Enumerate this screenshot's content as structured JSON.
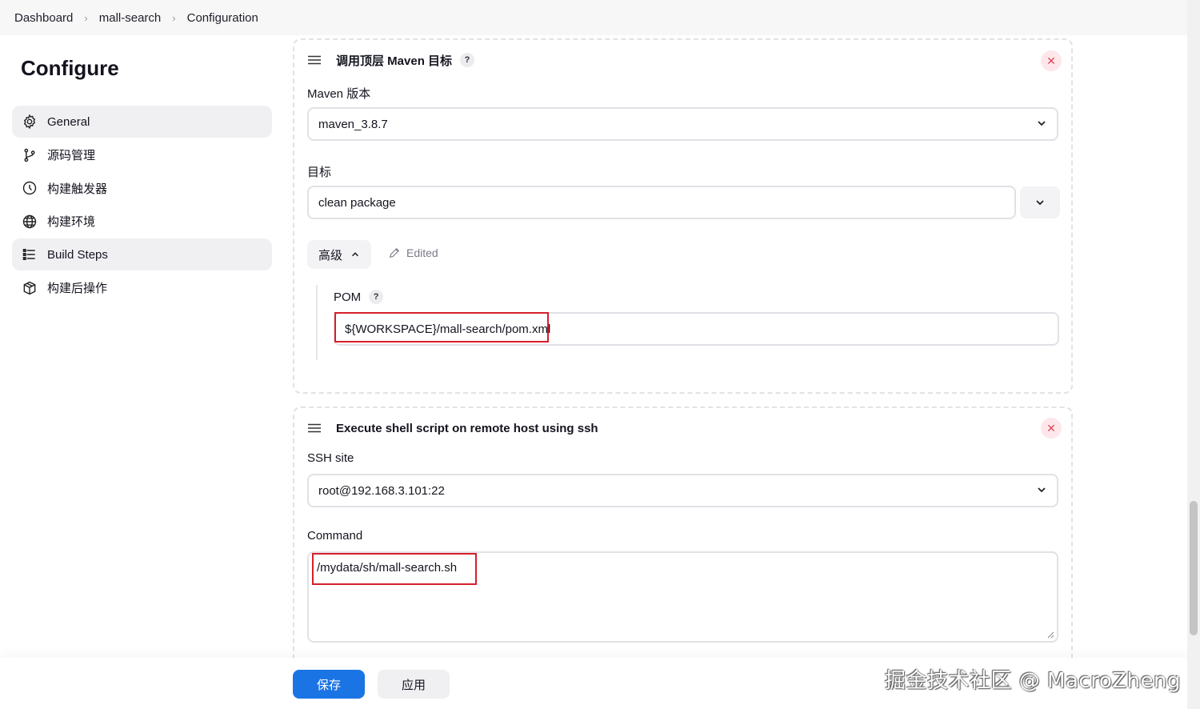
{
  "breadcrumb": [
    "Dashboard",
    "mall-search",
    "Configuration"
  ],
  "page_title": "Configure",
  "sidebar": {
    "items": [
      {
        "label": "General",
        "icon": "gear-icon",
        "active": true
      },
      {
        "label": "源码管理",
        "icon": "branch-icon",
        "active": false
      },
      {
        "label": "构建触发器",
        "icon": "clock-icon",
        "active": false
      },
      {
        "label": "构建环境",
        "icon": "globe-icon",
        "active": false
      },
      {
        "label": "Build Steps",
        "icon": "list-icon",
        "active": true
      },
      {
        "label": "构建后操作",
        "icon": "package-icon",
        "active": false
      }
    ]
  },
  "maven_step": {
    "title": "调用顶层 Maven 目标",
    "help": "?",
    "maven_version_label": "Maven 版本",
    "maven_version_value": "maven_3.8.7",
    "goals_label": "目标",
    "goals_value": "clean package",
    "advanced_label": "高级",
    "edited_label": "Edited",
    "pom_label": "POM",
    "pom_help": "?",
    "pom_value": "${WORKSPACE}/mall-search/pom.xml"
  },
  "ssh_step": {
    "title": "Execute shell script on remote host using ssh",
    "ssh_site_label": "SSH site",
    "ssh_site_value": "root@192.168.3.101:22",
    "command_label": "Command",
    "command_value": "/mydata/sh/mall-search.sh"
  },
  "footer": {
    "save_label": "保存",
    "apply_label": "应用"
  },
  "watermark": "掘金技术社区 @ MacroZheng",
  "colors": {
    "primary": "#1b74e4",
    "highlight_outline": "#d61f2c",
    "close_bg": "#fde7ea",
    "close_fg": "#e0435a"
  }
}
